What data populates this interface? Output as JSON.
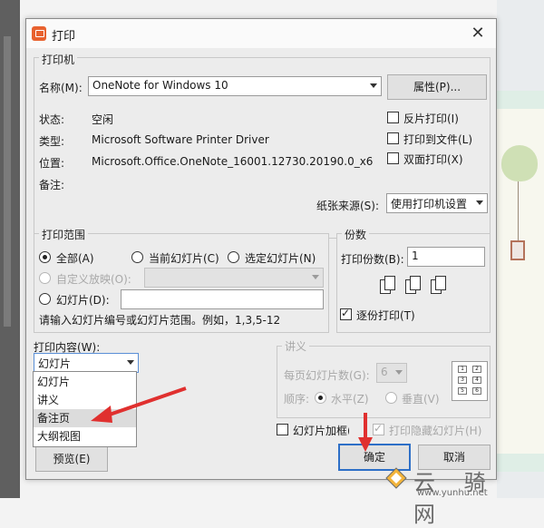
{
  "dialog": {
    "title": "打印",
    "close_icon": "close-icon"
  },
  "printer": {
    "legend": "打印机",
    "name_label": "名称(M):",
    "name_value": "OneNote for Windows 10",
    "properties_button": "属性(P)...",
    "status_label": "状态:",
    "status_value": "空闲",
    "type_label": "类型:",
    "type_value": "Microsoft Software Printer Driver",
    "where_label": "位置:",
    "where_value": "Microsoft.Office.OneNote_16001.12730.20190.0_x6",
    "comment_label": "备注:",
    "reverse_print": "反片打印(I)",
    "print_to_file": "打印到文件(L)",
    "duplex": "双面打印(X)",
    "paper_source_label": "纸张来源(S):",
    "paper_source_value": "使用打印机设置"
  },
  "range": {
    "legend": "打印范围",
    "all": "全部(A)",
    "current_slide": "当前幻灯片(C)",
    "selected_slides": "选定幻灯片(N)",
    "custom_show": "自定义放映(O):",
    "slides": "幻灯片(D):",
    "hint": "请输入幻灯片编号或幻灯片范围。例如，1,3,5-12"
  },
  "copies": {
    "legend": "份数",
    "count_label": "打印份数(B):",
    "count_value": "1",
    "collate": "逐份打印(T)"
  },
  "content": {
    "label": "打印内容(W):",
    "selected": "幻灯片",
    "options": [
      "幻灯片",
      "讲义",
      "备注页",
      "大纲视图"
    ],
    "highlighted_index": 2
  },
  "handouts": {
    "legend": "讲义",
    "per_page_label": "每页幻灯片数(G):",
    "per_page_value": "6",
    "order_label": "顺序:",
    "horizontal": "水平(Z)",
    "vertical": "垂直(V)",
    "grid_numbers": [
      "1",
      "2",
      "3",
      "4",
      "5",
      "6"
    ]
  },
  "options": {
    "frame_slides": "幻灯片加框(R)",
    "print_hidden": "打印隐藏幻灯片(H)"
  },
  "buttons": {
    "preview": "预览(E)",
    "ok": "确定",
    "cancel": "取消"
  },
  "watermark": {
    "text": "云 骑 网",
    "url": "www.yunhu.net"
  },
  "colors": {
    "arrow": "#e0302f",
    "accent_icon": "#e8622f"
  }
}
